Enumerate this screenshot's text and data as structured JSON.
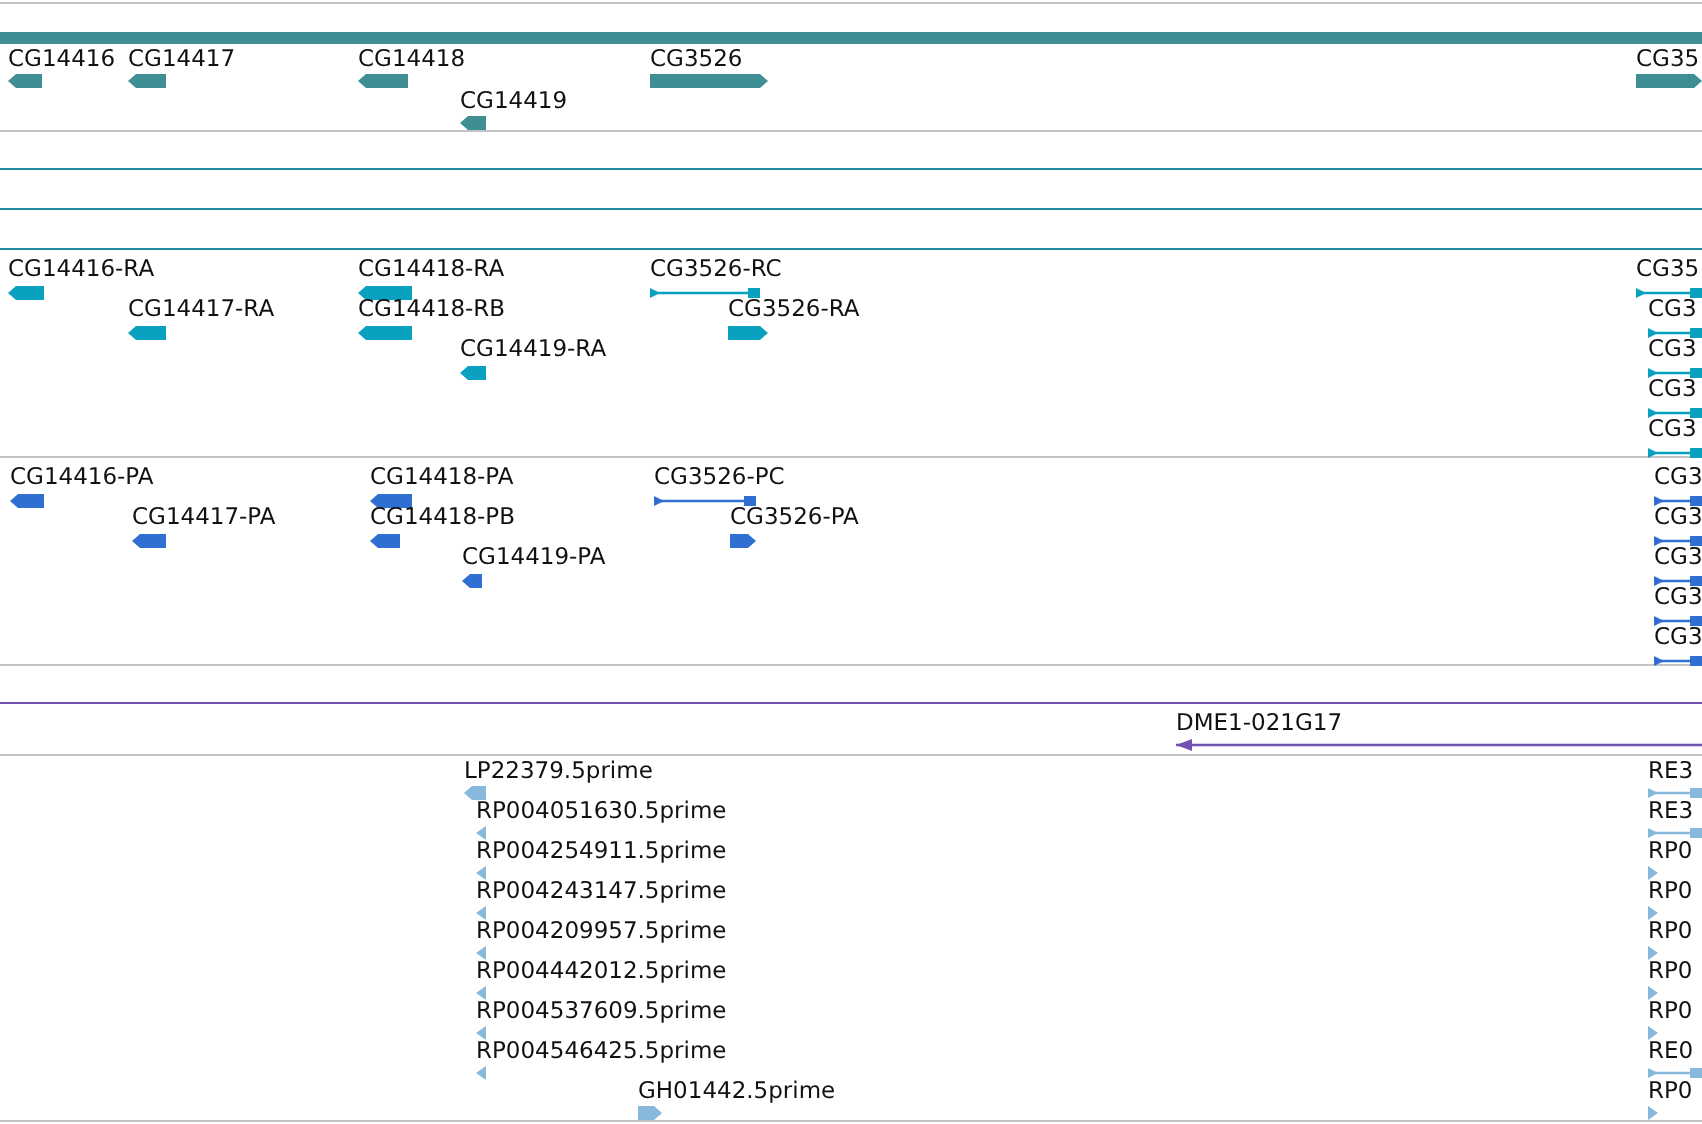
{
  "tracks": [
    {
      "kind": "gene",
      "color": "#3f8e94",
      "features": [
        {
          "label": "CG14416",
          "kind": "block",
          "reverse": true
        },
        {
          "label": "CG14417",
          "kind": "block",
          "reverse": true
        },
        {
          "label": "CG14418",
          "kind": "block",
          "reverse": true
        },
        {
          "label": "CG14419",
          "kind": "block",
          "reverse": true
        },
        {
          "label": "CG3526",
          "kind": "block",
          "reverse": false
        },
        {
          "label": "CG35",
          "kind": "block",
          "reverse": false
        }
      ]
    },
    {
      "kind": "transcript",
      "color": "#0aa0c0",
      "features": [
        {
          "label": "CG14416-RA",
          "kind": "block",
          "reverse": true
        },
        {
          "label": "CG14417-RA",
          "kind": "block",
          "reverse": true
        },
        {
          "label": "CG14418-RA",
          "kind": "block",
          "reverse": true
        },
        {
          "label": "CG14418-RB",
          "kind": "block",
          "reverse": true
        },
        {
          "label": "CG14419-RA",
          "kind": "block",
          "reverse": true
        },
        {
          "label": "CG3526-RC",
          "kind": "spliced",
          "reverse": false
        },
        {
          "label": "CG3526-RA",
          "kind": "block",
          "reverse": false
        },
        {
          "label": "CG35",
          "kind": "spliced",
          "reverse": false
        },
        {
          "label": "CG3",
          "kind": "spliced",
          "reverse": false
        },
        {
          "label": "CG3",
          "kind": "spliced",
          "reverse": false
        },
        {
          "label": "CG3",
          "kind": "spliced",
          "reverse": false
        },
        {
          "label": "CG3",
          "kind": "spliced",
          "reverse": false
        }
      ]
    },
    {
      "kind": "protein",
      "color": "#2f6fd2",
      "features": [
        {
          "label": "CG14416-PA",
          "kind": "block",
          "reverse": true
        },
        {
          "label": "CG14417-PA",
          "kind": "block",
          "reverse": true
        },
        {
          "label": "CG14418-PA",
          "kind": "block",
          "reverse": true
        },
        {
          "label": "CG14418-PB",
          "kind": "block",
          "reverse": true
        },
        {
          "label": "CG14419-PA",
          "kind": "block",
          "reverse": true
        },
        {
          "label": "CG3526-PC",
          "kind": "spliced",
          "reverse": false
        },
        {
          "label": "CG3526-PA",
          "kind": "block",
          "reverse": false
        },
        {
          "label": "CG3",
          "kind": "spliced",
          "reverse": false
        },
        {
          "label": "CG3",
          "kind": "spliced",
          "reverse": false
        },
        {
          "label": "CG3",
          "kind": "spliced",
          "reverse": false
        },
        {
          "label": "CG3",
          "kind": "spliced",
          "reverse": false
        },
        {
          "label": "CG3",
          "kind": "spliced",
          "reverse": false
        }
      ]
    },
    {
      "kind": "clone",
      "color": "#6f52b0",
      "features": [
        {
          "label": "DME1-021G17",
          "kind": "line",
          "reverse": true
        }
      ]
    },
    {
      "kind": "est",
      "color": "#88b8dc",
      "features": [
        {
          "label": "LP22379.5prime",
          "kind": "block",
          "reverse": true
        },
        {
          "label": "RP004051630.5prime",
          "kind": "tick",
          "reverse": true
        },
        {
          "label": "RP004254911.5prime",
          "kind": "tick",
          "reverse": true
        },
        {
          "label": "RP004243147.5prime",
          "kind": "tick",
          "reverse": true
        },
        {
          "label": "RP004209957.5prime",
          "kind": "tick",
          "reverse": true
        },
        {
          "label": "RP004442012.5prime",
          "kind": "tick",
          "reverse": true
        },
        {
          "label": "RP004537609.5prime",
          "kind": "tick",
          "reverse": true
        },
        {
          "label": "RP004546425.5prime",
          "kind": "tick",
          "reverse": true
        },
        {
          "label": "GH01442.5prime",
          "kind": "block",
          "reverse": false
        },
        {
          "label": "RE3",
          "kind": "spliced",
          "reverse": false
        },
        {
          "label": "RE3",
          "kind": "spliced",
          "reverse": false
        },
        {
          "label": "RP0",
          "kind": "tick",
          "reverse": false
        },
        {
          "label": "RP0",
          "kind": "tick",
          "reverse": false
        },
        {
          "label": "RP0",
          "kind": "tick",
          "reverse": false
        },
        {
          "label": "RP0",
          "kind": "tick",
          "reverse": false
        },
        {
          "label": "RP0",
          "kind": "tick",
          "reverse": false
        },
        {
          "label": "RE0",
          "kind": "spliced",
          "reverse": false
        },
        {
          "label": "RP0",
          "kind": "tick",
          "reverse": false
        }
      ]
    }
  ]
}
